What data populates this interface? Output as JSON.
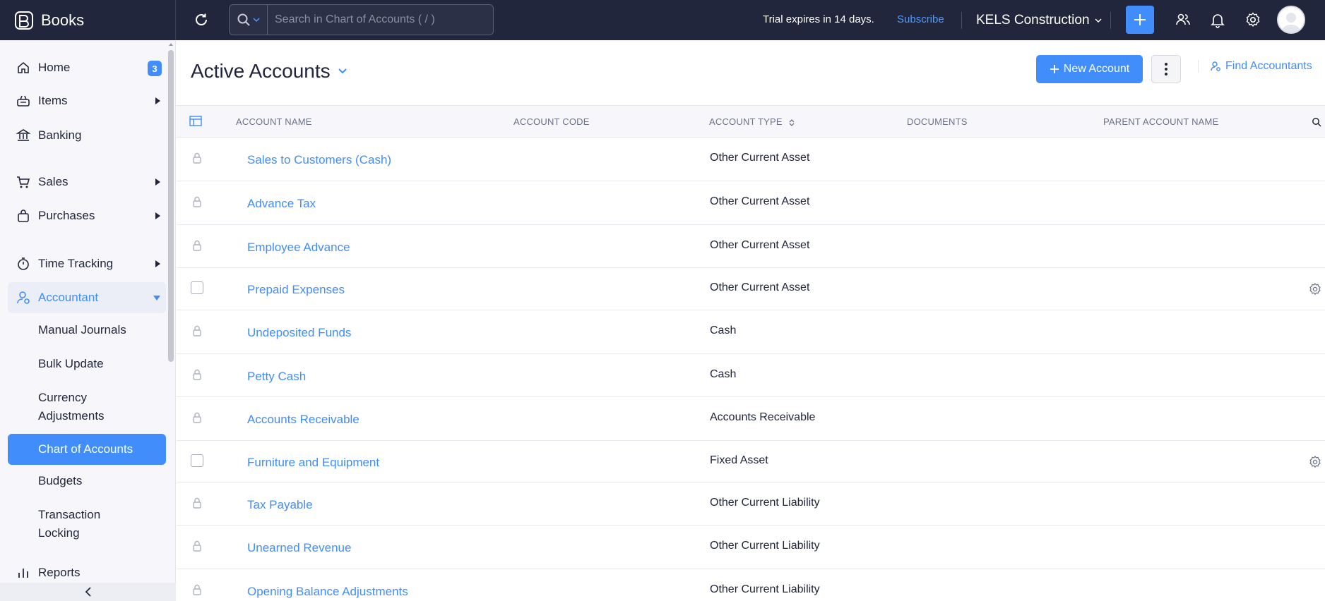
{
  "topbar": {
    "brand": "Books",
    "search_placeholder": "Search in Chart of Accounts ( / )",
    "trial_text": "Trial expires in 14 days.",
    "subscribe_label": "Subscribe",
    "org_name": "KELS Construction",
    "accent": "#408dfb",
    "background": "#21263c"
  },
  "sidebar": {
    "home": {
      "label": "Home",
      "badge": "3",
      "icon": "home-icon"
    },
    "items": {
      "label": "Items",
      "icon": "basket-icon"
    },
    "banking": {
      "label": "Banking",
      "icon": "bank-icon"
    },
    "sales": {
      "label": "Sales",
      "icon": "cart-icon"
    },
    "purchases": {
      "label": "Purchases",
      "icon": "bag-icon"
    },
    "time_tracking": {
      "label": "Time Tracking",
      "icon": "stopwatch-icon"
    },
    "accountant": {
      "label": "Accountant",
      "icon": "accountant-icon",
      "sub": {
        "manual_journals": "Manual Journals",
        "bulk_update": "Bulk Update",
        "currency_adj_1": "Currency",
        "currency_adj_2": "Adjustments",
        "chart_of_accounts": "Chart of Accounts",
        "budgets": "Budgets",
        "transaction_locking_1": "Transaction",
        "transaction_locking_2": "Locking"
      }
    },
    "reports": {
      "label": "Reports",
      "icon": "bar-chart-icon"
    }
  },
  "main": {
    "title": "Active Accounts",
    "new_account_label": "New Account",
    "find_accountants_label": "Find Accountants",
    "columns": {
      "name": "ACCOUNT NAME",
      "code": "ACCOUNT CODE",
      "type": "ACCOUNT TYPE",
      "documents": "DOCUMENTS",
      "parent": "PARENT ACCOUNT NAME"
    },
    "rows": [
      {
        "name": "Sales to Customers (Cash)",
        "type": "Other Current Asset",
        "locked": true
      },
      {
        "name": "Advance Tax",
        "type": "Other Current Asset",
        "locked": true
      },
      {
        "name": "Employee Advance",
        "type": "Other Current Asset",
        "locked": true
      },
      {
        "name": "Prepaid Expenses",
        "type": "Other Current Asset",
        "locked": false
      },
      {
        "name": "Undeposited Funds",
        "type": "Cash",
        "locked": true
      },
      {
        "name": "Petty Cash",
        "type": "Cash",
        "locked": true
      },
      {
        "name": "Accounts Receivable",
        "type": "Accounts Receivable",
        "locked": true
      },
      {
        "name": "Furniture and Equipment",
        "type": "Fixed Asset",
        "locked": false
      },
      {
        "name": "Tax Payable",
        "type": "Other Current Liability",
        "locked": true
      },
      {
        "name": "Unearned Revenue",
        "type": "Other Current Liability",
        "locked": true
      },
      {
        "name": "Opening Balance Adjustments",
        "type": "Other Current Liability",
        "locked": true
      }
    ]
  }
}
